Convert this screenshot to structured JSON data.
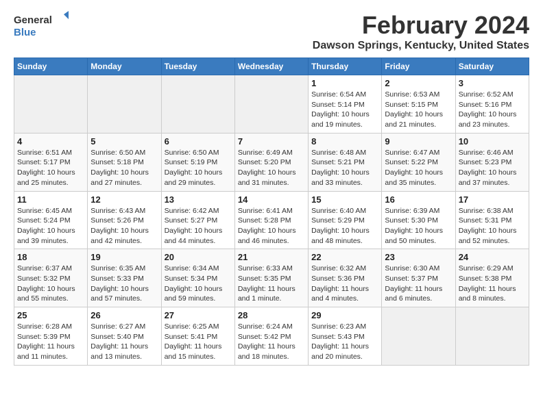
{
  "logo": {
    "line1": "General",
    "line2": "Blue"
  },
  "title": "February 2024",
  "subtitle": "Dawson Springs, Kentucky, United States",
  "days_of_week": [
    "Sunday",
    "Monday",
    "Tuesday",
    "Wednesday",
    "Thursday",
    "Friday",
    "Saturday"
  ],
  "weeks": [
    [
      {
        "day": "",
        "info": "",
        "empty": true
      },
      {
        "day": "",
        "info": "",
        "empty": true
      },
      {
        "day": "",
        "info": "",
        "empty": true
      },
      {
        "day": "",
        "info": "",
        "empty": true
      },
      {
        "day": "1",
        "info": "Sunrise: 6:54 AM\nSunset: 5:14 PM\nDaylight: 10 hours\nand 19 minutes."
      },
      {
        "day": "2",
        "info": "Sunrise: 6:53 AM\nSunset: 5:15 PM\nDaylight: 10 hours\nand 21 minutes."
      },
      {
        "day": "3",
        "info": "Sunrise: 6:52 AM\nSunset: 5:16 PM\nDaylight: 10 hours\nand 23 minutes."
      }
    ],
    [
      {
        "day": "4",
        "info": "Sunrise: 6:51 AM\nSunset: 5:17 PM\nDaylight: 10 hours\nand 25 minutes."
      },
      {
        "day": "5",
        "info": "Sunrise: 6:50 AM\nSunset: 5:18 PM\nDaylight: 10 hours\nand 27 minutes."
      },
      {
        "day": "6",
        "info": "Sunrise: 6:50 AM\nSunset: 5:19 PM\nDaylight: 10 hours\nand 29 minutes."
      },
      {
        "day": "7",
        "info": "Sunrise: 6:49 AM\nSunset: 5:20 PM\nDaylight: 10 hours\nand 31 minutes."
      },
      {
        "day": "8",
        "info": "Sunrise: 6:48 AM\nSunset: 5:21 PM\nDaylight: 10 hours\nand 33 minutes."
      },
      {
        "day": "9",
        "info": "Sunrise: 6:47 AM\nSunset: 5:22 PM\nDaylight: 10 hours\nand 35 minutes."
      },
      {
        "day": "10",
        "info": "Sunrise: 6:46 AM\nSunset: 5:23 PM\nDaylight: 10 hours\nand 37 minutes."
      }
    ],
    [
      {
        "day": "11",
        "info": "Sunrise: 6:45 AM\nSunset: 5:24 PM\nDaylight: 10 hours\nand 39 minutes."
      },
      {
        "day": "12",
        "info": "Sunrise: 6:43 AM\nSunset: 5:26 PM\nDaylight: 10 hours\nand 42 minutes."
      },
      {
        "day": "13",
        "info": "Sunrise: 6:42 AM\nSunset: 5:27 PM\nDaylight: 10 hours\nand 44 minutes."
      },
      {
        "day": "14",
        "info": "Sunrise: 6:41 AM\nSunset: 5:28 PM\nDaylight: 10 hours\nand 46 minutes."
      },
      {
        "day": "15",
        "info": "Sunrise: 6:40 AM\nSunset: 5:29 PM\nDaylight: 10 hours\nand 48 minutes."
      },
      {
        "day": "16",
        "info": "Sunrise: 6:39 AM\nSunset: 5:30 PM\nDaylight: 10 hours\nand 50 minutes."
      },
      {
        "day": "17",
        "info": "Sunrise: 6:38 AM\nSunset: 5:31 PM\nDaylight: 10 hours\nand 52 minutes."
      }
    ],
    [
      {
        "day": "18",
        "info": "Sunrise: 6:37 AM\nSunset: 5:32 PM\nDaylight: 10 hours\nand 55 minutes."
      },
      {
        "day": "19",
        "info": "Sunrise: 6:35 AM\nSunset: 5:33 PM\nDaylight: 10 hours\nand 57 minutes."
      },
      {
        "day": "20",
        "info": "Sunrise: 6:34 AM\nSunset: 5:34 PM\nDaylight: 10 hours\nand 59 minutes."
      },
      {
        "day": "21",
        "info": "Sunrise: 6:33 AM\nSunset: 5:35 PM\nDaylight: 11 hours\nand 1 minute."
      },
      {
        "day": "22",
        "info": "Sunrise: 6:32 AM\nSunset: 5:36 PM\nDaylight: 11 hours\nand 4 minutes."
      },
      {
        "day": "23",
        "info": "Sunrise: 6:30 AM\nSunset: 5:37 PM\nDaylight: 11 hours\nand 6 minutes."
      },
      {
        "day": "24",
        "info": "Sunrise: 6:29 AM\nSunset: 5:38 PM\nDaylight: 11 hours\nand 8 minutes."
      }
    ],
    [
      {
        "day": "25",
        "info": "Sunrise: 6:28 AM\nSunset: 5:39 PM\nDaylight: 11 hours\nand 11 minutes."
      },
      {
        "day": "26",
        "info": "Sunrise: 6:27 AM\nSunset: 5:40 PM\nDaylight: 11 hours\nand 13 minutes."
      },
      {
        "day": "27",
        "info": "Sunrise: 6:25 AM\nSunset: 5:41 PM\nDaylight: 11 hours\nand 15 minutes."
      },
      {
        "day": "28",
        "info": "Sunrise: 6:24 AM\nSunset: 5:42 PM\nDaylight: 11 hours\nand 18 minutes."
      },
      {
        "day": "29",
        "info": "Sunrise: 6:23 AM\nSunset: 5:43 PM\nDaylight: 11 hours\nand 20 minutes."
      },
      {
        "day": "",
        "info": "",
        "empty": true
      },
      {
        "day": "",
        "info": "",
        "empty": true
      }
    ]
  ]
}
